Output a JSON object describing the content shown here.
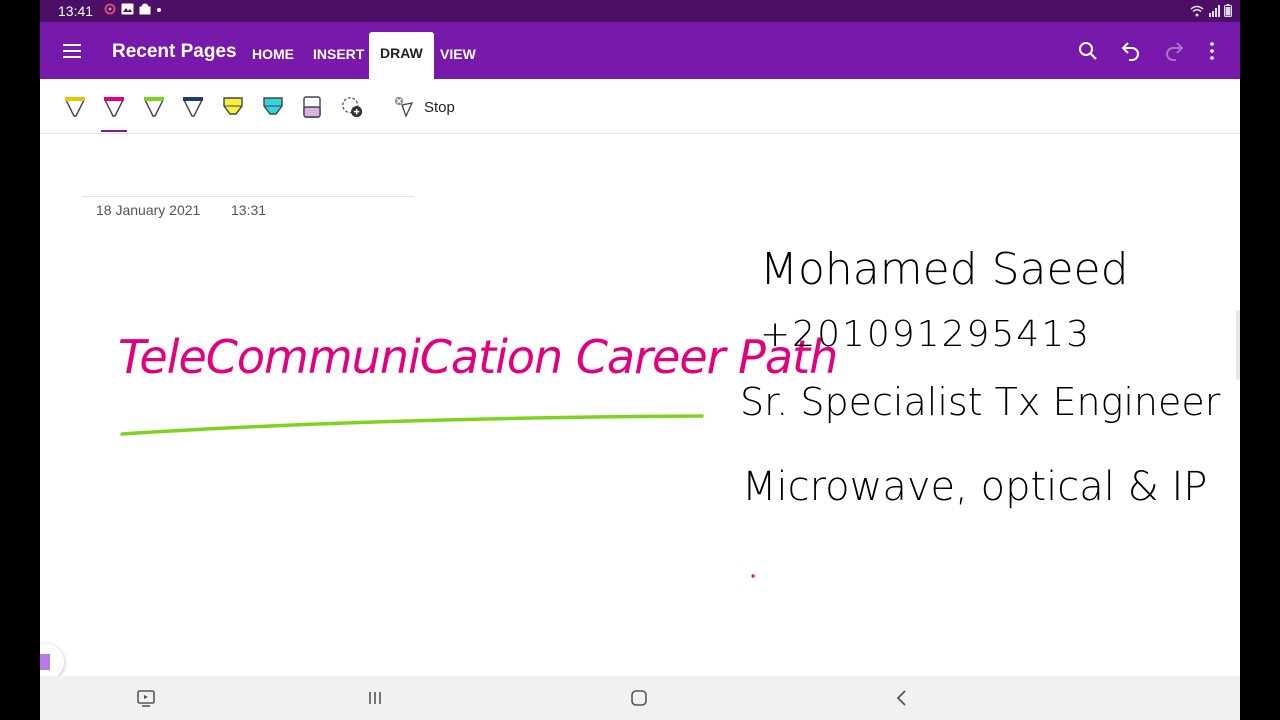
{
  "status_bar": {
    "time": "13:41",
    "left_icons": [
      "sync-icon",
      "photo-icon",
      "notification-icon",
      "dot-icon"
    ],
    "right_icons": [
      "wifi-icon",
      "signal-icon",
      "battery-icon"
    ]
  },
  "app_bar": {
    "title": "Recent Pages",
    "tabs": [
      {
        "label": "HOME",
        "active": false
      },
      {
        "label": "INSERT",
        "active": false
      },
      {
        "label": "DRAW",
        "active": true
      },
      {
        "label": "VIEW",
        "active": false
      }
    ],
    "actions": [
      "search-icon",
      "undo-icon",
      "redo-icon",
      "more-options-icon"
    ],
    "colors": {
      "brand": "#7719aa",
      "status_bar": "#4b0f66"
    }
  },
  "draw_toolbar": {
    "pens": [
      {
        "name": "pen-yellow",
        "color": "#f2c200",
        "selected": false
      },
      {
        "name": "pen-magenta",
        "color": "#e3007d",
        "selected": true
      },
      {
        "name": "pen-green",
        "color": "#7ed321",
        "selected": false
      },
      {
        "name": "pen-navy",
        "color": "#1f3b73",
        "selected": false
      },
      {
        "name": "highlighter-yellow",
        "color": "#f7ef3c",
        "selected": false
      },
      {
        "name": "highlighter-cyan",
        "color": "#30d5e0",
        "selected": false
      },
      {
        "name": "highlighter-lavender",
        "color": "#d6b3e8",
        "selected": false
      }
    ],
    "add_pen_icon": "add-pen-icon",
    "stop_label": "Stop"
  },
  "page": {
    "date": "18 January 2021",
    "time": "13:31",
    "ink": {
      "heading": "TeleCommuniCation Career Path",
      "name": "Mohamed Saeed",
      "phone": "+201091295413",
      "role": "Sr. Specialist Tx Engineer",
      "skills": "Microwave, optical & IP",
      "colors": {
        "heading": "#e3007d",
        "underline": "#7ed321",
        "notes": "#000000"
      }
    }
  },
  "nav_bar": {
    "buttons": [
      "screenshot-icon",
      "recents-icon",
      "home-icon",
      "back-icon"
    ]
  }
}
